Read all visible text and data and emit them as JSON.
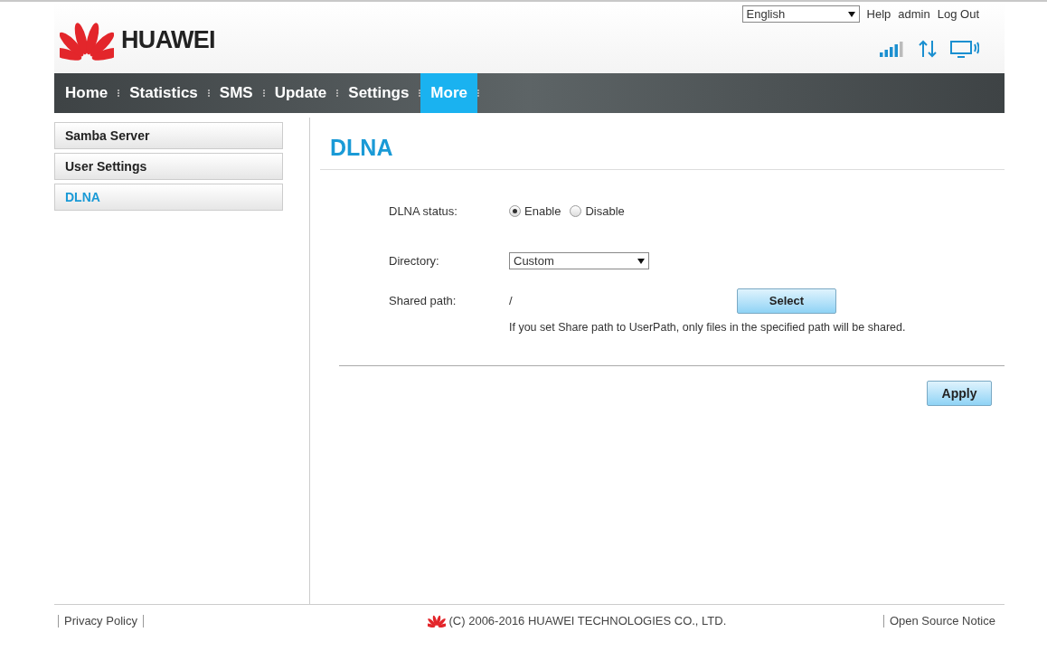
{
  "header": {
    "brand": "HUAWEI",
    "language": "English",
    "links": [
      "Help",
      "admin",
      "Log Out"
    ]
  },
  "nav": [
    {
      "label": "Home",
      "selected": false
    },
    {
      "label": "Statistics",
      "selected": false
    },
    {
      "label": "SMS",
      "selected": false
    },
    {
      "label": "Update",
      "selected": false
    },
    {
      "label": "Settings",
      "selected": false
    },
    {
      "label": "More",
      "selected": true
    }
  ],
  "sidebar": {
    "items": [
      {
        "label": "Samba Server",
        "selected": false
      },
      {
        "label": "User Settings",
        "selected": false
      },
      {
        "label": "DLNA",
        "selected": true
      }
    ]
  },
  "main": {
    "title": "DLNA",
    "status": {
      "label": "DLNA status:",
      "options": [
        {
          "label": "Enable",
          "selected": true
        },
        {
          "label": "Disable",
          "selected": false
        }
      ]
    },
    "directory": {
      "label": "Directory:",
      "value": "Custom"
    },
    "shared_path": {
      "label": "Shared path:",
      "value": "/",
      "button": "Select",
      "hint": "If you set Share path to UserPath, only files in the specified path will be shared."
    },
    "apply": "Apply"
  },
  "footer": {
    "privacy": "Privacy Policy",
    "copyright": "(C) 2006-2016 HUAWEI TECHNOLOGIES CO., LTD.",
    "open_source": "Open Source Notice"
  }
}
